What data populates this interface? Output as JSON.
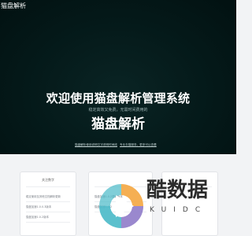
{
  "header": {
    "brand": "猫盘解析"
  },
  "hero": {
    "title": "欢迎使用猫盘解析管理系统",
    "subtitle": "稳定高效又免费，无需时间费用的",
    "logo_text": "猫盘解析",
    "links": [
      "猫盘解析使用说明文字说明时间线",
      "专业去猫服务，更多可以查看"
    ]
  },
  "cards": [
    {
      "heading": "关注数字",
      "items": [
        "稳定使用至其他文档解析更新",
        "猫盘加速1.0.0.3版本",
        "猫盘加速1.0.2版本"
      ]
    },
    {
      "heading": "",
      "items": [
        "猫盘加速1.0.2更新版本",
        "猫盘加速1.0.2"
      ]
    },
    {
      "heading": "",
      "items": []
    }
  ],
  "watermark": {
    "text": "酷数据",
    "subtext": "KUIDC",
    "colors": {
      "orange": "#f4a640",
      "teal": "#49b9c8",
      "purple": "#8f7bc9"
    }
  }
}
